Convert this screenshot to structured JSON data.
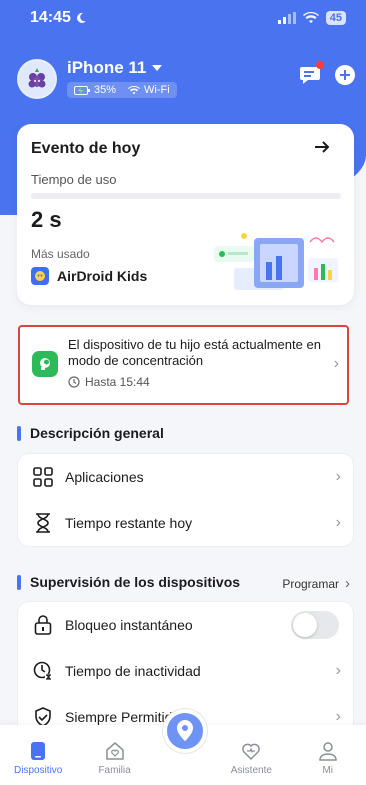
{
  "status_bar": {
    "time": "14:45",
    "battery": "45"
  },
  "device": {
    "name": "iPhone 11",
    "battery": "35%",
    "network": "Wi-Fi"
  },
  "event_card": {
    "title": "Evento de hoy",
    "usage_label": "Tiempo de uso",
    "usage_value": "2 s",
    "usage_fraction": 0.0,
    "most_used_label": "Más usado",
    "most_used_app": "AirDroid Kids"
  },
  "focus_alert": {
    "message": "El dispositivo de tu hijo está actualmente en modo de concentración",
    "until": "Hasta 15:44"
  },
  "overview": {
    "title": "Descripción general",
    "items": [
      {
        "label": "Aplicaciones",
        "icon": "grid-icon"
      },
      {
        "label": "Tiempo restante hoy",
        "icon": "hourglass-icon"
      }
    ]
  },
  "supervision": {
    "title": "Supervisión de los dispositivos",
    "link": "Programar",
    "items": [
      {
        "label": "Bloqueo instantáneo",
        "icon": "lock-icon",
        "toggle": false
      },
      {
        "label": "Tiempo de inactividad",
        "icon": "clock-moon-icon"
      },
      {
        "label": "Siempre Permitid",
        "icon": "shield-check-icon"
      }
    ]
  },
  "tabbar": {
    "tabs": [
      "Dispositivo",
      "Familia",
      "Asistente",
      "Mi"
    ],
    "active": "Dispositivo"
  },
  "colors": {
    "accent": "#4a73f0",
    "alert_border": "#d9473c",
    "focus_green": "#2dbb5a"
  }
}
